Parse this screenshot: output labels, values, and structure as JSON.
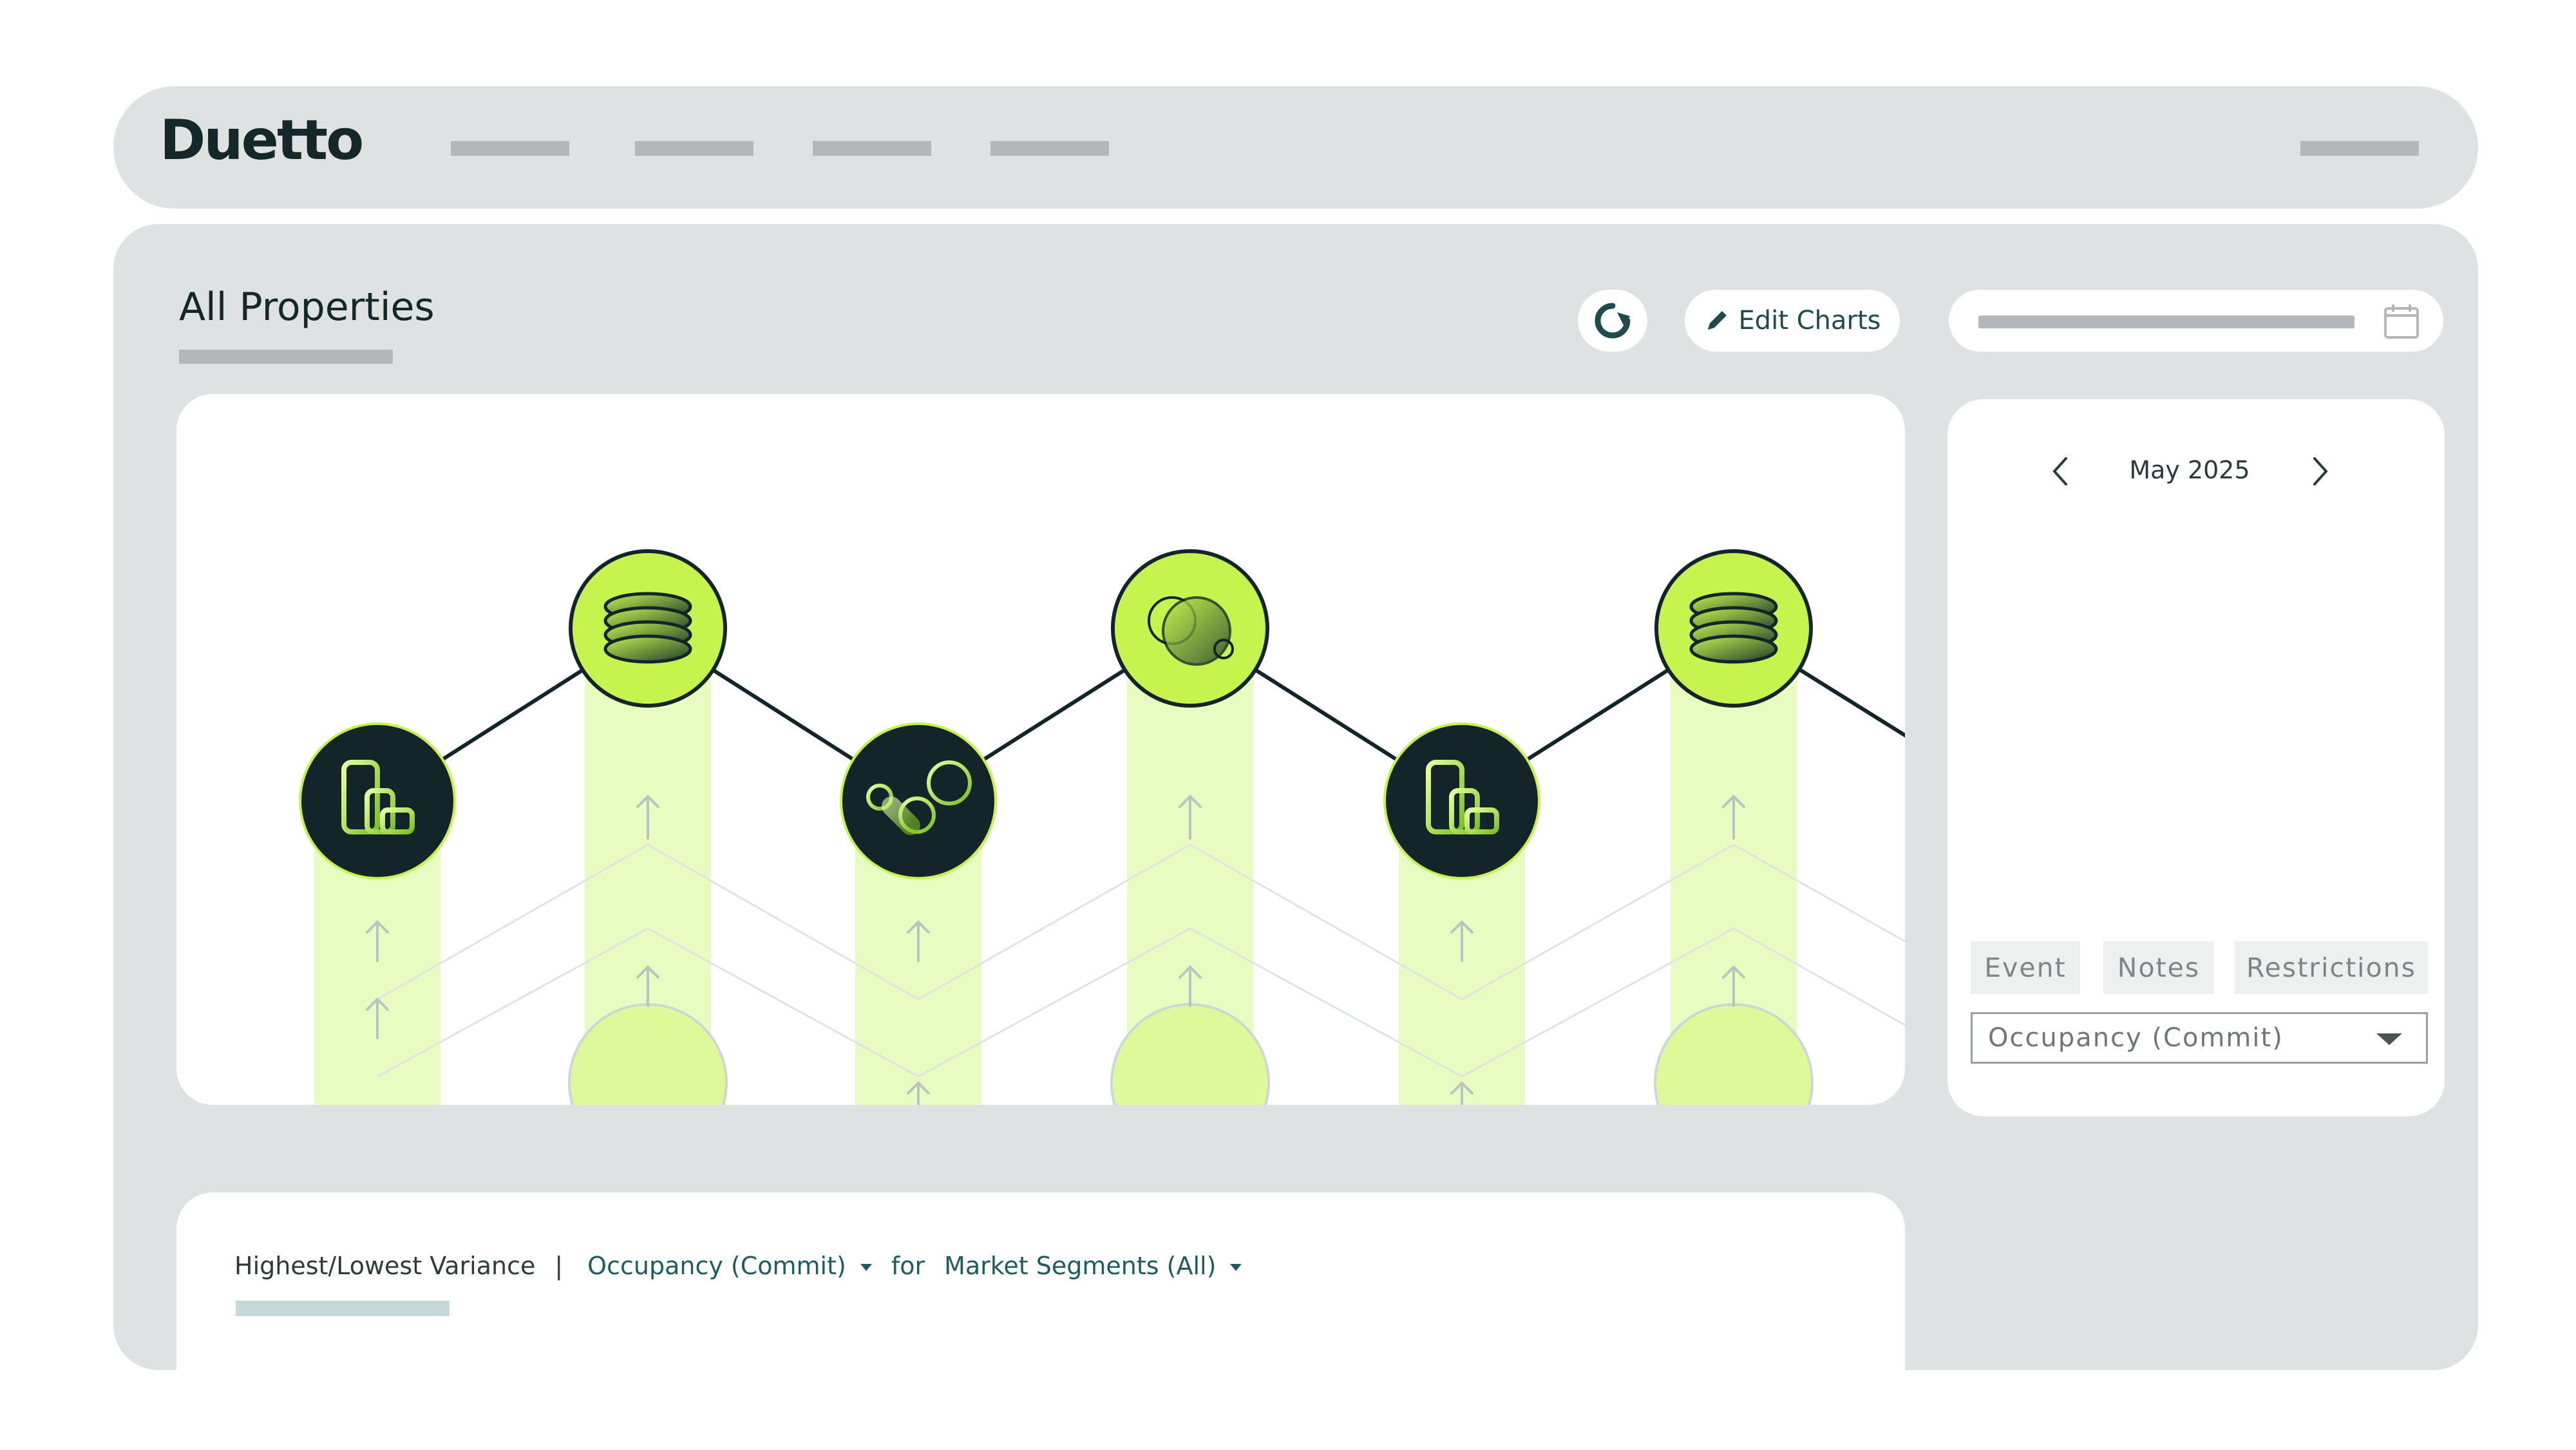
{
  "app": {
    "logo_text": "Duetto"
  },
  "page": {
    "title": "All Properties"
  },
  "toolbar": {
    "refresh_icon": "refresh-icon",
    "edit_icon": "pencil-icon",
    "edit_label": "Edit Charts",
    "calendar_icon": "calendar-icon"
  },
  "calendar": {
    "month_label": "May 2025",
    "prev_icon": "chevron-left-icon",
    "next_icon": "chevron-right-icon",
    "tabs": [
      "Event",
      "Notes",
      "Restrictions"
    ],
    "selected_metric": "Occupancy (Commit)"
  },
  "variance": {
    "title": "Highest/Lowest Variance",
    "separator": "|",
    "metric": "Occupancy (Commit)",
    "for_text": "for",
    "segment": "Market Segments (All)"
  },
  "colors": {
    "accent_lime": "#c6f34e",
    "pale_lime": "#e8fbc0",
    "dark_navy": "#14252a",
    "panel_gray": "#dfe2e3",
    "placeholder_gray": "#b4b7ba"
  },
  "illustration": {
    "nodes": [
      {
        "icon": "blocks-icon",
        "style": "dark"
      },
      {
        "icon": "stacked-coins-icon",
        "style": "lime"
      },
      {
        "icon": "bubbles-icon",
        "style": "dark"
      },
      {
        "icon": "circles-icon",
        "style": "lime"
      },
      {
        "icon": "blocks-icon",
        "style": "dark"
      },
      {
        "icon": "stacked-coins-icon",
        "style": "lime"
      }
    ]
  }
}
